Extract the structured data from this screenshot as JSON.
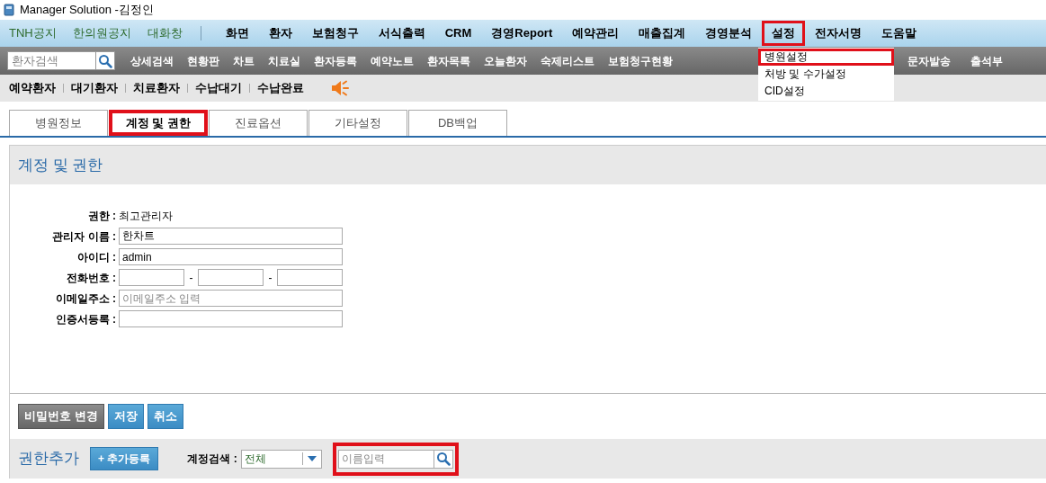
{
  "window": {
    "title": "Manager Solution -김정인"
  },
  "top_links": [
    "TNH공지",
    "한의원공지",
    "대화창"
  ],
  "main_menu": [
    {
      "label": "화면",
      "selected": false
    },
    {
      "label": "환자",
      "selected": false
    },
    {
      "label": "보험청구",
      "selected": false
    },
    {
      "label": "서식출력",
      "selected": false
    },
    {
      "label": "CRM",
      "selected": false
    },
    {
      "label": "경영Report",
      "selected": false
    },
    {
      "label": "예약관리",
      "selected": false
    },
    {
      "label": "매출집계",
      "selected": false
    },
    {
      "label": "경영분석",
      "selected": false
    },
    {
      "label": "설정",
      "selected": true
    },
    {
      "label": "전자서명",
      "selected": false
    },
    {
      "label": "도움말",
      "selected": false
    }
  ],
  "dropdown": [
    {
      "label": "병원설정",
      "selected": true
    },
    {
      "label": "처방 및 수가설정",
      "selected": false
    },
    {
      "label": "CID설정",
      "selected": false
    }
  ],
  "search": {
    "placeholder": "환자검색"
  },
  "toolbar_left": [
    "상세검색",
    "현황판",
    "차트",
    "치료실",
    "환자등록",
    "예약노트",
    "환자목록",
    "오늘환자",
    "숙제리스트",
    "보험청구현황"
  ],
  "toolbar_right": [
    "문자발송",
    "출석부"
  ],
  "status_links": [
    "예약환자",
    "대기환자",
    "치료환자",
    "수납대기",
    "수납완료"
  ],
  "tabs": [
    {
      "label": "병원정보",
      "selected": false
    },
    {
      "label": "계정 및 권한",
      "selected": true
    },
    {
      "label": "진료옵션",
      "selected": false
    },
    {
      "label": "기타설정",
      "selected": false
    },
    {
      "label": "DB백업",
      "selected": false
    }
  ],
  "section_title": "계정 및 권한",
  "form": [
    {
      "kind": "text",
      "label": "권한 :",
      "value": "최고관리자"
    },
    {
      "kind": "input",
      "label": "관리자 이름 :",
      "value": "한차트"
    },
    {
      "kind": "input",
      "label": "아이디 :",
      "value": "admin"
    },
    {
      "kind": "phone",
      "label": "전화번호 :",
      "separators": [
        "-",
        "-"
      ]
    },
    {
      "kind": "input",
      "label": "이메일주소 :",
      "placeholder": "이메일주소 입력"
    },
    {
      "kind": "input",
      "label": "인증서등록 :"
    }
  ],
  "buttons": [
    {
      "label": "비밀번호 변경",
      "kind": "dark"
    },
    {
      "label": "저장",
      "kind": "primary"
    },
    {
      "label": "취소",
      "kind": "primary"
    }
  ],
  "bottom": {
    "title": "권한추가",
    "add_button": "+ 추가등록",
    "search_label": "계정검색 :",
    "select_value": "전체",
    "name_placeholder": "이름입력"
  }
}
